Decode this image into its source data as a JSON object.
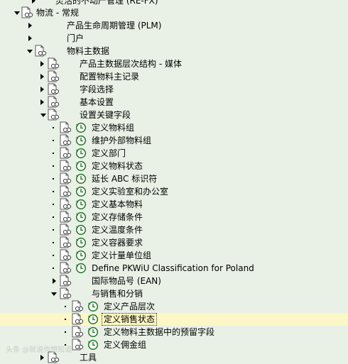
{
  "tree": {
    "top_partial": "灵活的不动产管理 (RE-FX)",
    "logistics": "物流 - 常规",
    "plm": "产品生命周期管理 (PLM)",
    "portal": "门户",
    "material_master": "物料主数据",
    "mm_children": [
      "产品主数据层次结构 - 媒体",
      "配置物料主记录",
      "字段选择",
      "基本设置",
      "设置关键字段"
    ],
    "key_fields_items": [
      "定义物料组",
      "维护外部物料组",
      "定义部门",
      "定义物料状态",
      "延长 ABC 标识符",
      "定义实验室和办公室",
      "定义基本物料",
      "定义存储条件",
      "定义温度条件",
      "定义容器要求",
      "定义计量单位组",
      "Define PKWiU Classification for Poland"
    ],
    "ean": "国际物品号 (EAN)",
    "sales": "与销售和分销",
    "sales_items": [
      "定义产品层次",
      "定义销售状态",
      "定义物料主数据中的预留字段",
      "定义佣金组"
    ],
    "bottom_partial": "工具"
  },
  "watermark": "头条 @就说你想知道"
}
